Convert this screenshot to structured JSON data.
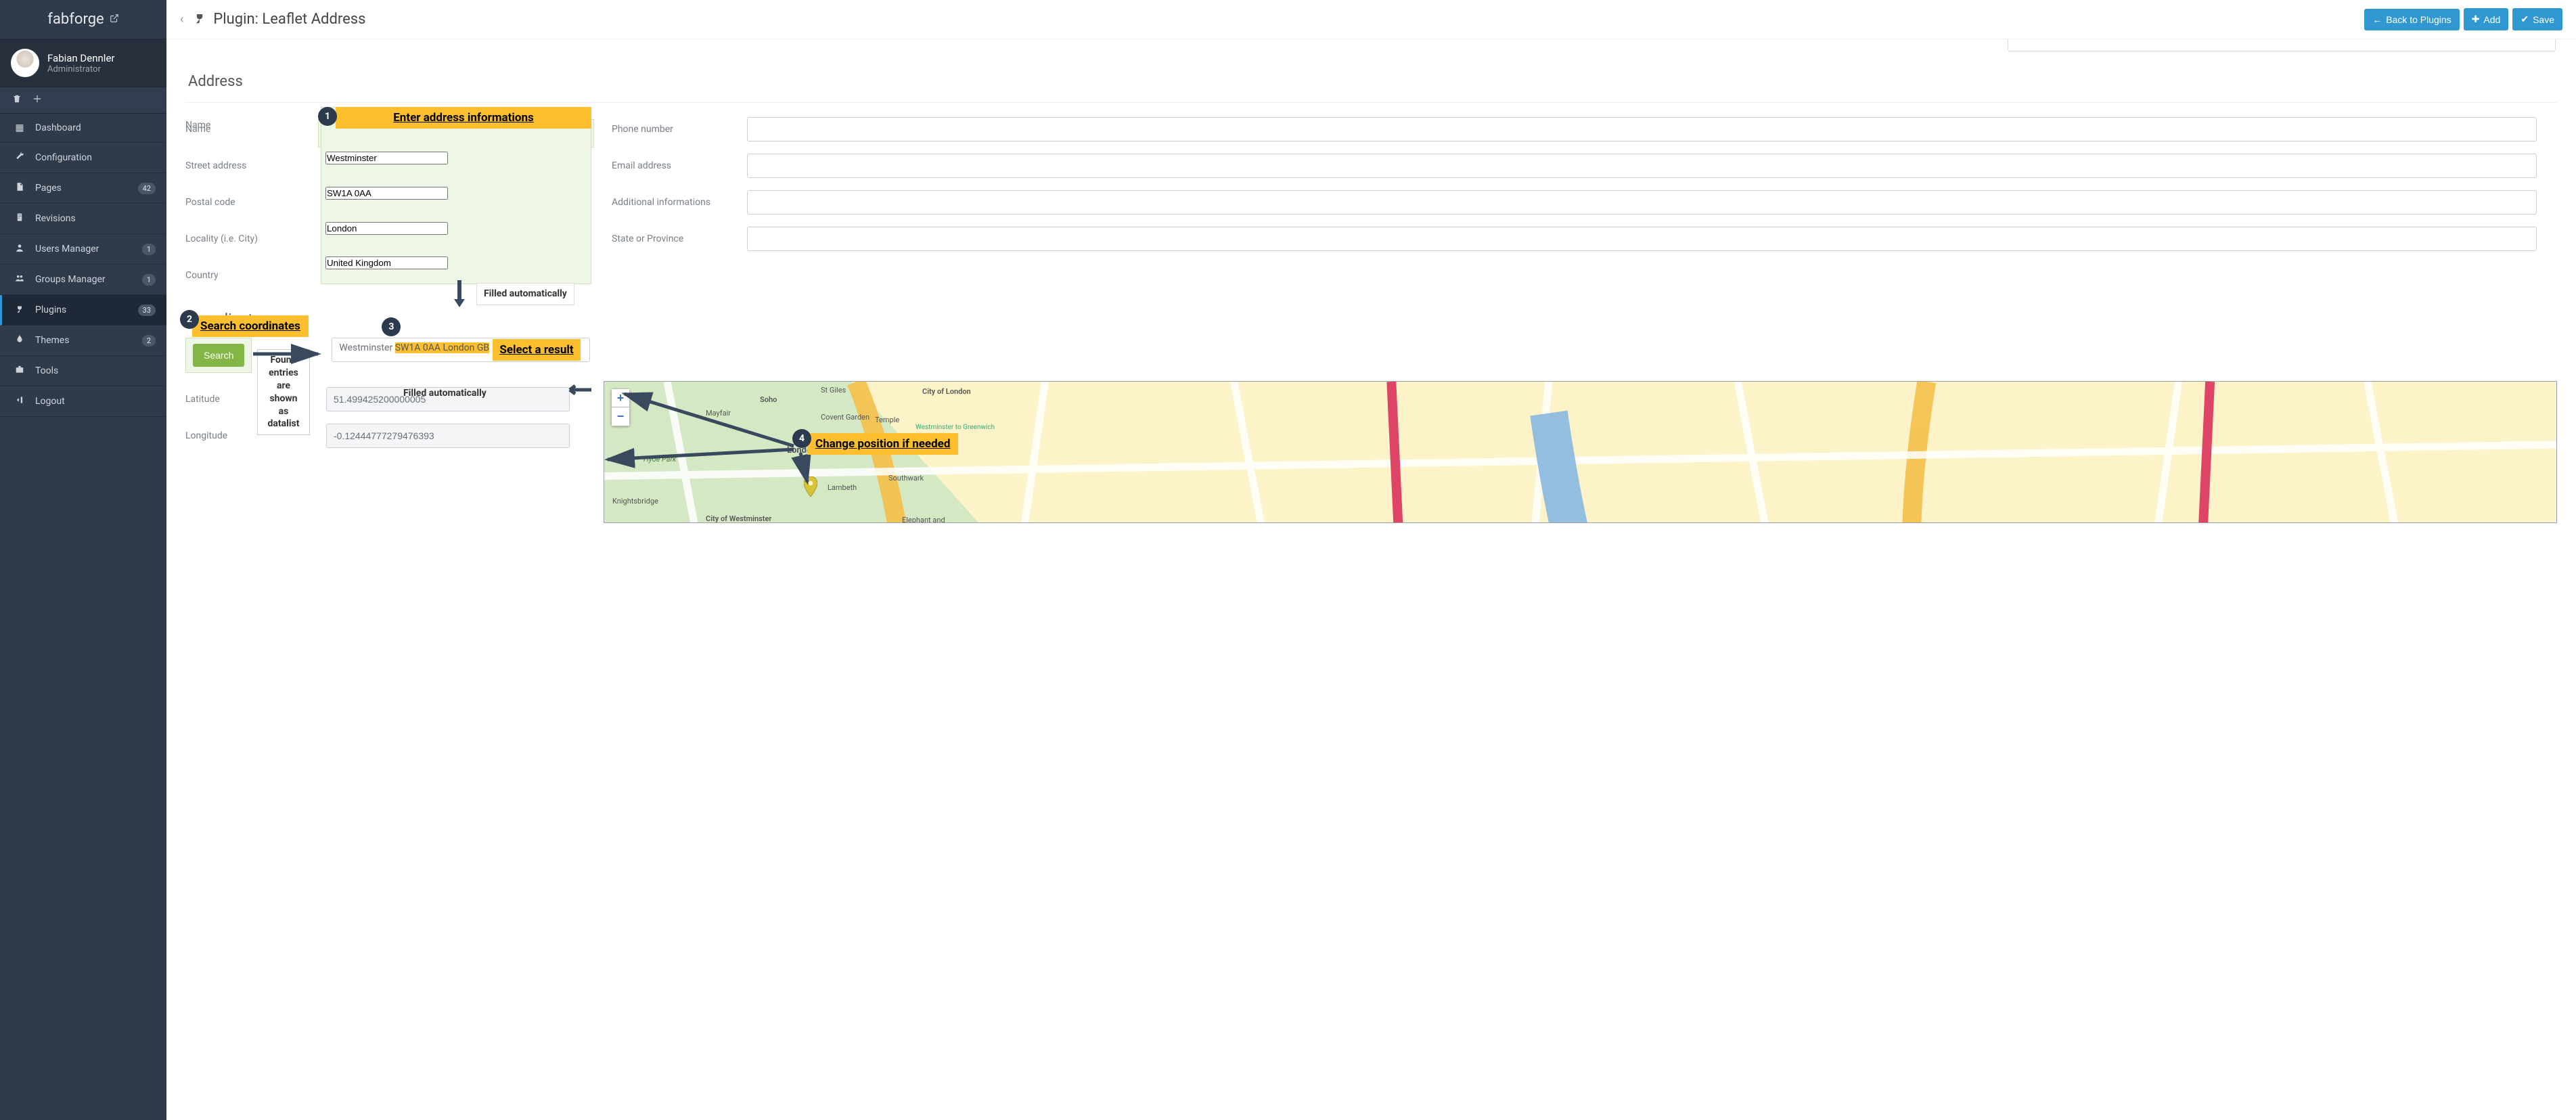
{
  "brand": "fabforge",
  "user": {
    "name": "Fabian Dennler",
    "role": "Administrator"
  },
  "nav": {
    "dashboard": "Dashboard",
    "configuration": "Configuration",
    "pages": "Pages",
    "pages_badge": "42",
    "revisions": "Revisions",
    "users": "Users Manager",
    "users_badge": "1",
    "groups": "Groups Manager",
    "groups_badge": "1",
    "plugins": "Plugins",
    "plugins_badge": "33",
    "themes": "Themes",
    "themes_badge": "2",
    "tools": "Tools",
    "logout": "Logout"
  },
  "topbar": {
    "title": "Plugin: Leaflet Address",
    "back": "Back to Plugins",
    "add": "Add",
    "save": "Save"
  },
  "sections": {
    "address": "Address",
    "coords": "oordinates"
  },
  "labels": {
    "name": "Name",
    "street": "Street address",
    "postal": "Postal code",
    "city": "Locality (i.e. City)",
    "country": "Country",
    "phone": "Phone number",
    "email": "Email address",
    "info": "Additional informations",
    "state": "State or Province",
    "lat": "Latitude",
    "lon": "Longitude"
  },
  "values": {
    "street": "Westminster",
    "postal": "SW1A 0AA",
    "city": "London",
    "country": "United Kingdom",
    "result_prefix": "Westminster ",
    "result_highlight": "SW1A 0AA London GB",
    "lat": "51.499425200000005",
    "lon": "-0.12444777279476393"
  },
  "buttons": {
    "search": "Search"
  },
  "callouts": {
    "c1": "Enter address informations",
    "c2": "Search coordinates",
    "c3": "Select a result",
    "c4": "Change position if needed",
    "filled1": "Filled automatically",
    "filled2": "Filled automatically",
    "found": "Found entries are shown as datalist"
  },
  "map": {
    "labels": [
      "Mayfair",
      "Soho",
      "St Giles",
      "City of London",
      "Covent Garden",
      "Temple",
      "Westminster to Greenwich",
      "Hyde Park",
      "London",
      "Knightsbridge",
      "City of Westminster",
      "Lambeth",
      "Southwark",
      "Elephant and"
    ]
  }
}
